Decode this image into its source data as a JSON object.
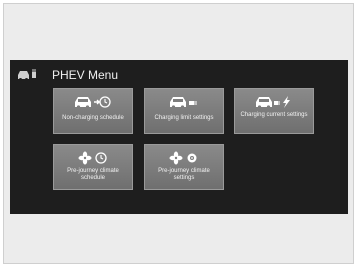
{
  "menu": {
    "title": "PHEV Menu",
    "header_icon": "car-plug-icon"
  },
  "tiles": [
    {
      "label": "Non-charging schedule",
      "icon": "car-clock-icon"
    },
    {
      "label": "Charging limit settings",
      "icon": "car-plug-icon"
    },
    {
      "label": "Charging current settings",
      "icon": "car-lightning-icon"
    },
    {
      "label": "Pre-journey climate schedule",
      "icon": "fan-clock-icon"
    },
    {
      "label": "Pre-journey climate settings",
      "icon": "fan-settings-icon"
    }
  ],
  "colors": {
    "screen_bg": "#1e1e1e",
    "tile_bg": "#7d7d7d",
    "text": "#f0f0f0"
  }
}
